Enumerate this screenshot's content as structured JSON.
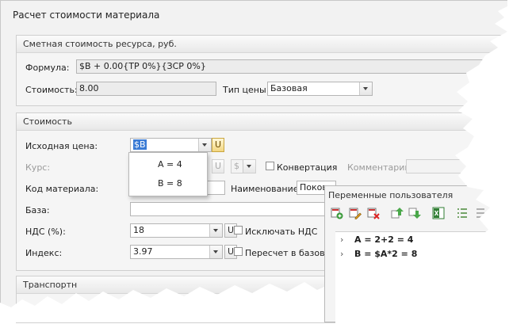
{
  "window": {
    "title": "Расчет стоимости материала"
  },
  "resource_group": {
    "header": "Сметная стоимость ресурса, руб.",
    "formula_label": "Формула:",
    "formula_value": "$B + 0.00{ТР 0%}{ЗСР 0%}",
    "cost_label": "Стоимость:",
    "cost_value": "8.00",
    "price_type_label": "Тип цены:",
    "price_type_value": "Базовая"
  },
  "cost_group": {
    "header": "Стоимость",
    "source_price_label": "Исходная цена:",
    "source_price_value": "$B",
    "u_button": "U",
    "rate_label": "Курс:",
    "currency_value": "$",
    "conversion_label": "Конвертация",
    "comment_label": "Комментарий",
    "material_code_label": "Код материала:",
    "name_label": "Наименование:",
    "name_value": "Поков",
    "base_label": "База:",
    "vat_label": "НДС (%):",
    "vat_value": "18",
    "exclude_vat_label": "Исключать НДС",
    "index_label": "Индекс:",
    "index_value": "3.97",
    "recalc_label": "Пересчет в базову"
  },
  "transport_group": {
    "header": "Транспортн"
  },
  "dropdown_popup": {
    "items": [
      "A = 4",
      "B = 8"
    ]
  },
  "variables_panel": {
    "title": "Переменные пользователя",
    "toolbar_icons": [
      "add-variable-icon",
      "edit-variable-icon",
      "delete-variable-icon",
      "move-up-icon",
      "move-down-icon",
      "excel-export-icon",
      "list-icon"
    ],
    "rows": [
      "A  =  2+2 = 4",
      "B  =  $A*2 = 8"
    ]
  },
  "colors": {
    "selection": "#3a7bd5",
    "u_button_gold": "#f2d680"
  }
}
